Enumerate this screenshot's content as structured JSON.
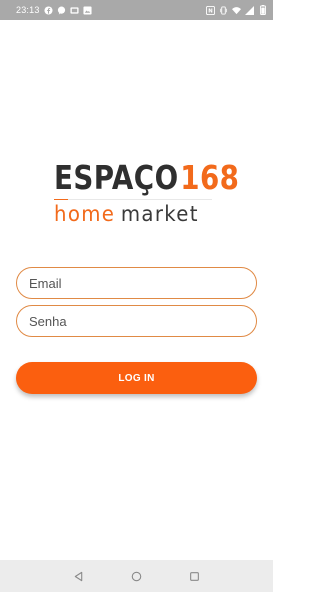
{
  "status_bar": {
    "time": "23:13",
    "icons_left": [
      "facebook-icon",
      "chat-icon",
      "photos-icon",
      "image-icon"
    ],
    "icons_right": [
      "nfc-icon",
      "vibrate-icon",
      "wifi-icon",
      "signal-icon",
      "battery-icon"
    ]
  },
  "logo": {
    "word": "ESPAÇO",
    "number": "168",
    "tagline_home": "home",
    "tagline_market": "market"
  },
  "form": {
    "email_placeholder": "Email",
    "password_placeholder": "Senha",
    "login_label": "LOG IN"
  },
  "nav_bar": {
    "buttons": [
      "back-icon",
      "home-icon",
      "recents-icon"
    ]
  },
  "colors": {
    "accent": "#fb5f0f",
    "input_border": "#e08a45",
    "status_bar": "#a9a9a9",
    "nav_bar": "#ececec"
  }
}
